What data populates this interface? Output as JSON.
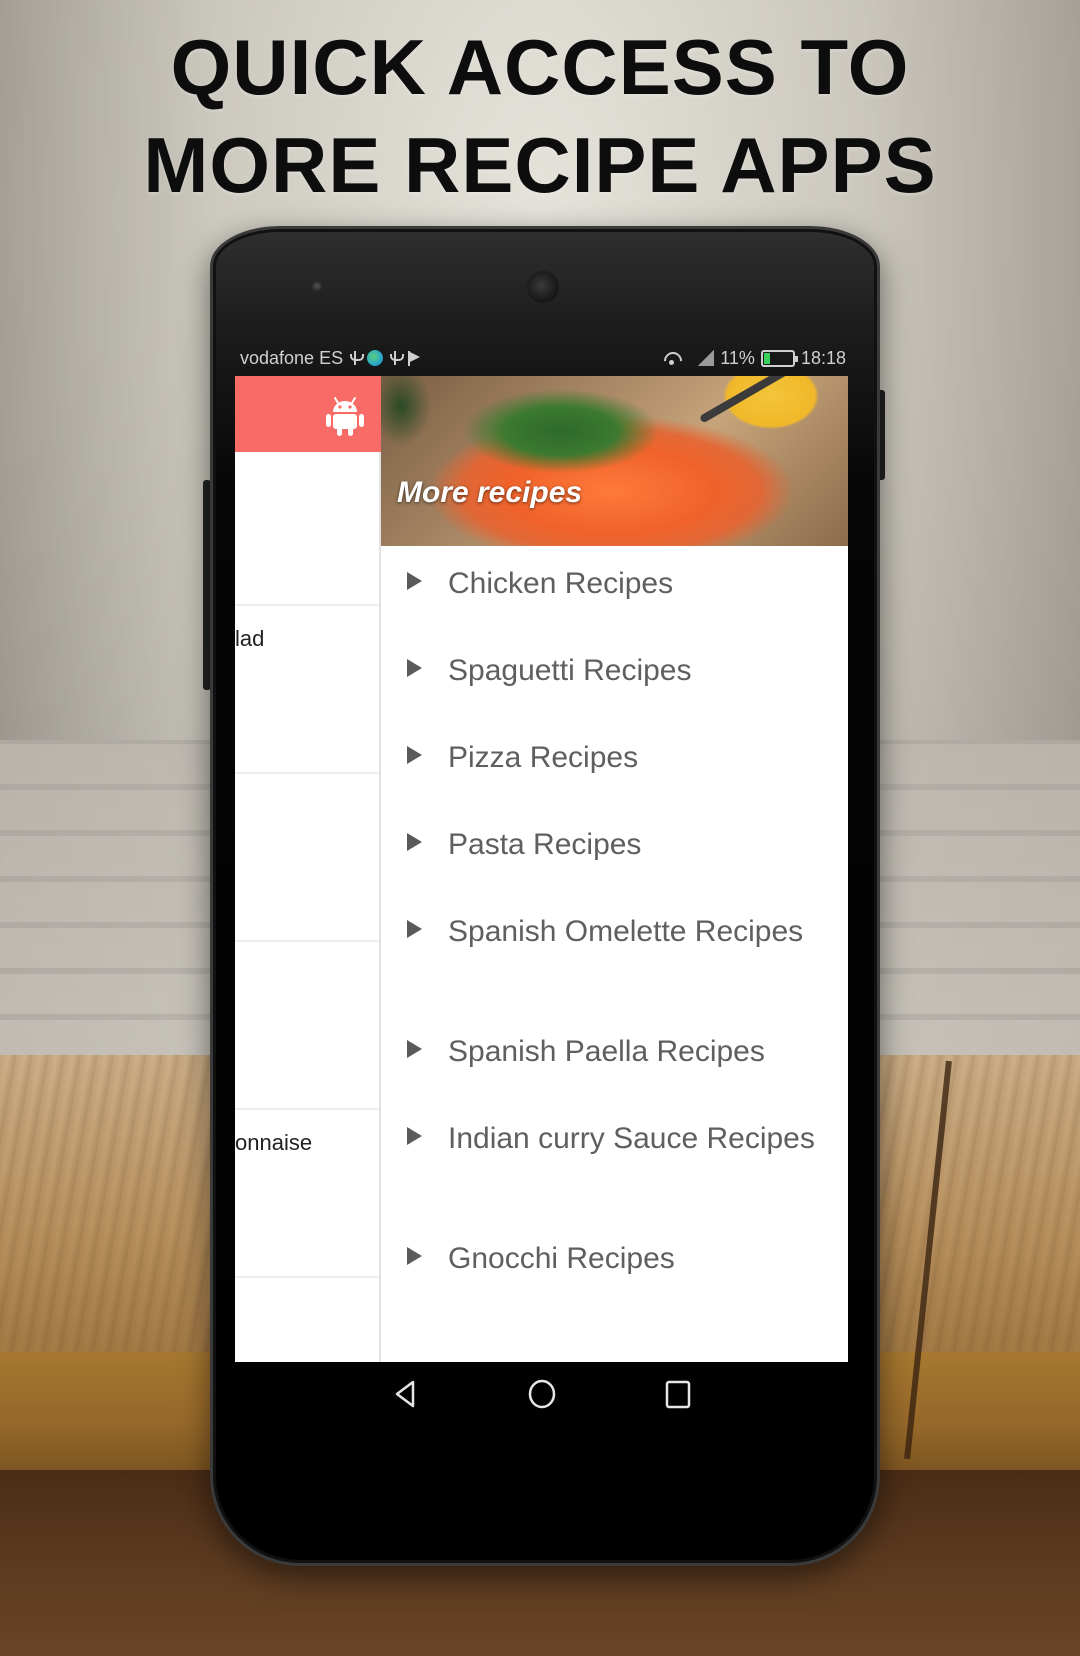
{
  "headline": {
    "line1": "QUICK ACCESS TO",
    "line2": "MORE RECIPE APPS"
  },
  "status_bar": {
    "carrier": "vodafone ES",
    "left_icons": [
      "usb-icon",
      "globe-icon",
      "usb-icon",
      "flag-icon"
    ],
    "right_icons": [
      "wifi-icon",
      "signal-icon",
      "battery-icon"
    ],
    "battery": "11%",
    "time": "18:18"
  },
  "app": {
    "toolbar_color": "#f96b66",
    "toolbar_icon": "android-icon",
    "left_rows": [
      {
        "text": ""
      },
      {
        "text": "lad"
      },
      {
        "text": ""
      },
      {
        "text": ""
      },
      {
        "text": "onnaise"
      },
      {
        "text": ""
      }
    ]
  },
  "drawer": {
    "header_title": "More recipes",
    "items": [
      {
        "label": "Chicken Recipes"
      },
      {
        "label": "Spaguetti Recipes"
      },
      {
        "label": "Pizza Recipes"
      },
      {
        "label": "Pasta Recipes"
      },
      {
        "label": "Spanish Omelette Recipes"
      },
      {
        "label": "Spanish Paella Recipes"
      },
      {
        "label": "Indian curry Sauce Recipes"
      },
      {
        "label": "Gnocchi Recipes"
      }
    ]
  },
  "nav_bar": {
    "buttons": [
      "back-icon",
      "home-icon",
      "recents-icon"
    ]
  }
}
